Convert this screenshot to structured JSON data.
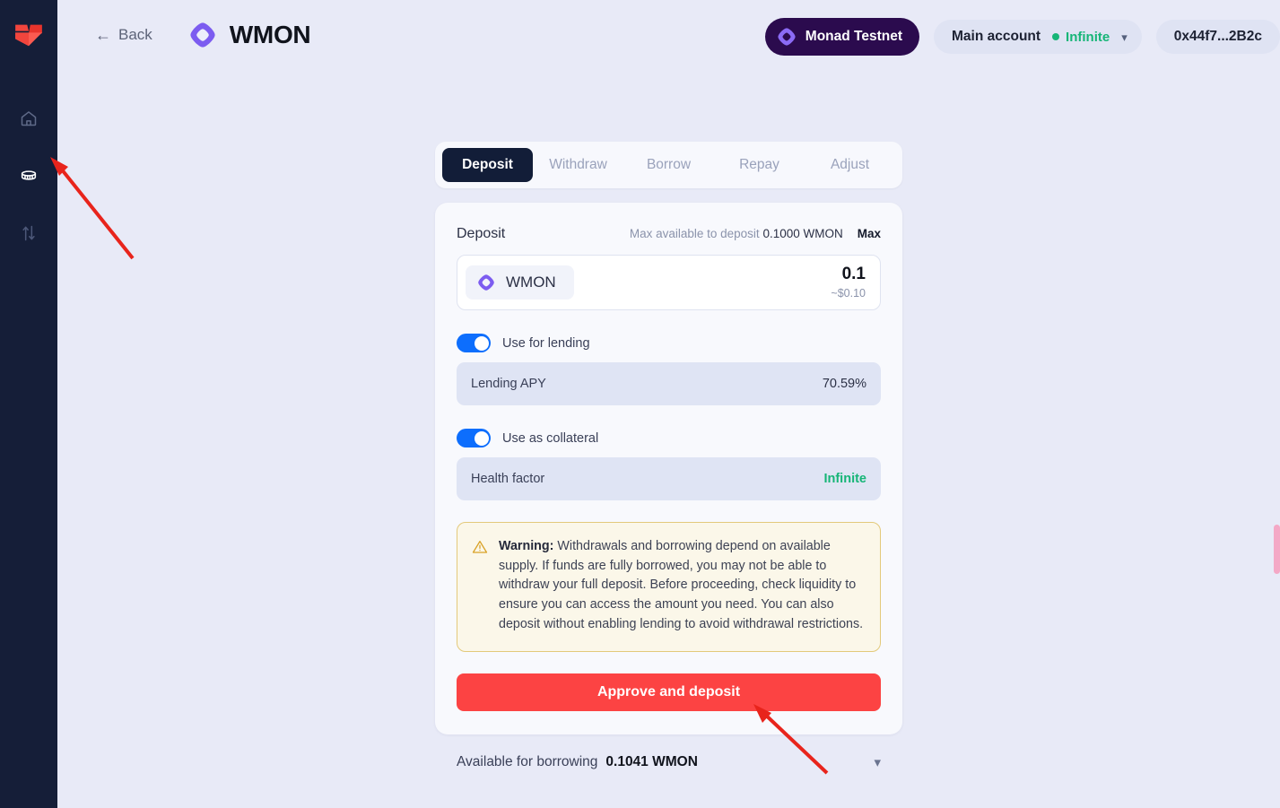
{
  "sidebar": {
    "logo_name": "brand-logo",
    "items": [
      {
        "icon": "home-icon",
        "name": "home",
        "active": false
      },
      {
        "icon": "coins-icon",
        "name": "markets",
        "active": true
      },
      {
        "icon": "swap-arrows-icon",
        "name": "swap",
        "active": false
      }
    ]
  },
  "header": {
    "back_label": "Back",
    "back_icon": "arrow-left-icon",
    "token_icon": "wmon-token-icon",
    "title": "WMON",
    "chain": {
      "label": "Monad Testnet",
      "icon": "monad-icon"
    },
    "account": {
      "name": "Main account",
      "health_label": "Infinite",
      "chevron": "chevron-down-icon"
    },
    "address": "0x44f7...2B2c"
  },
  "tabs": [
    {
      "label": "Deposit",
      "active": true
    },
    {
      "label": "Withdraw",
      "active": false
    },
    {
      "label": "Borrow",
      "active": false
    },
    {
      "label": "Repay",
      "active": false
    },
    {
      "label": "Adjust",
      "active": false
    }
  ],
  "deposit_card": {
    "label": "Deposit",
    "max_available_label": "Max available to deposit",
    "max_available_value": "0.1000 WMON",
    "max_button": "Max",
    "token": {
      "symbol": "WMON",
      "icon": "wmon-token-icon"
    },
    "amount": "0.1",
    "amount_usd": "~$0.10",
    "toggles": [
      {
        "label": "Use for lending",
        "on": true
      },
      {
        "label": "Use as collateral",
        "on": true
      }
    ],
    "stats": [
      {
        "key": "Lending APY",
        "value": "70.59%",
        "highlight": false
      },
      {
        "key": "Health factor",
        "value": "Infinite",
        "highlight": true
      }
    ],
    "warning": {
      "icon": "warning-triangle-icon",
      "bold_prefix": "Warning:",
      "text": " Withdrawals and borrowing depend on available supply. If funds are fully borrowed, you may not be able to withdraw your full deposit. Before proceeding, check liquidity to ensure you can access the amount you need. You can also deposit without enabling lending to avoid withdrawal restrictions."
    },
    "cta_label": "Approve and deposit"
  },
  "bottom_bar": {
    "label": "Available for borrowing",
    "value": "0.1041 WMON",
    "chevron": "chevron-down-icon"
  },
  "colors": {
    "page_bg": "#e8eaf7",
    "sidebar_bg": "#151e38",
    "brand_red": "#f2453d",
    "cta_red": "#fc4343",
    "accent_purple": "#7c5cf0",
    "chain_pill": "#2b0b4e",
    "toggle_blue": "#0d6efd",
    "green": "#16b577",
    "tab_active_bg": "#121d38",
    "warn_border": "#e3c97a",
    "warn_bg": "#fbf7e9",
    "annotation_arrow": "#e8241c"
  },
  "annotations": [
    {
      "name": "arrow-to-markets-icon",
      "color": "#e8241c"
    },
    {
      "name": "arrow-to-approve-button",
      "color": "#e8241c"
    }
  ]
}
